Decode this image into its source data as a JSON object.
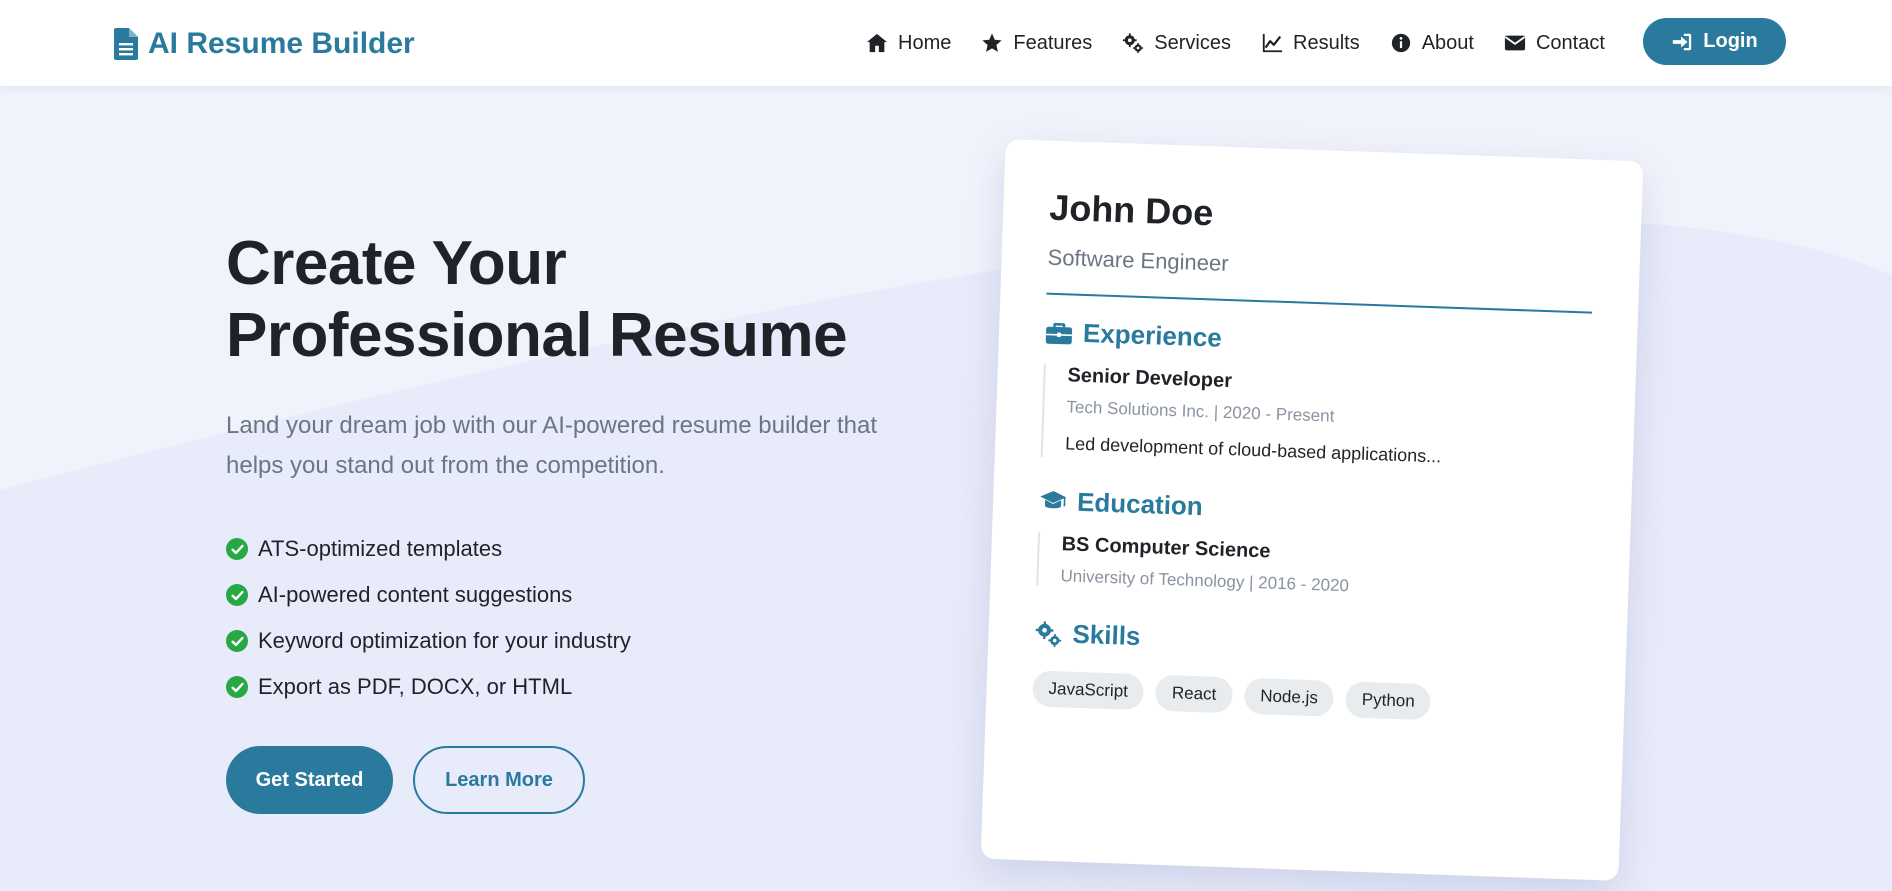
{
  "brand": {
    "name": "AI Resume Builder",
    "icon": "file-icon"
  },
  "nav": {
    "items": [
      {
        "label": "Home",
        "icon": "home-icon"
      },
      {
        "label": "Features",
        "icon": "star-icon"
      },
      {
        "label": "Services",
        "icon": "gears-icon"
      },
      {
        "label": "Results",
        "icon": "chart-line-icon"
      },
      {
        "label": "About",
        "icon": "info-icon"
      },
      {
        "label": "Contact",
        "icon": "envelope-icon"
      }
    ],
    "login_label": "Login"
  },
  "hero": {
    "title_line1": "Create Your",
    "title_line2": "Professional Resume",
    "subtitle": "Land your dream job with our AI-powered resume builder that helps you stand out from the competition.",
    "features": [
      "ATS-optimized templates",
      "AI-powered content suggestions",
      "Keyword optimization for your industry",
      "Export as PDF, DOCX, or HTML"
    ],
    "primary_cta": "Get Started",
    "secondary_cta": "Learn More"
  },
  "resume": {
    "name": "John Doe",
    "role": "Software Engineer",
    "experience": {
      "heading": "Experience",
      "title": "Senior Developer",
      "meta": "Tech Solutions Inc. | 2020 - Present",
      "desc": "Led development of cloud-based applications..."
    },
    "education": {
      "heading": "Education",
      "title": "BS Computer Science",
      "meta": "University of Technology | 2016 - 2020"
    },
    "skills": {
      "heading": "Skills",
      "items": [
        "JavaScript",
        "React",
        "Node.js",
        "Python"
      ]
    }
  },
  "colors": {
    "brand": "#2a7a9d",
    "check": "#28a745",
    "background": "#eef1fb"
  }
}
